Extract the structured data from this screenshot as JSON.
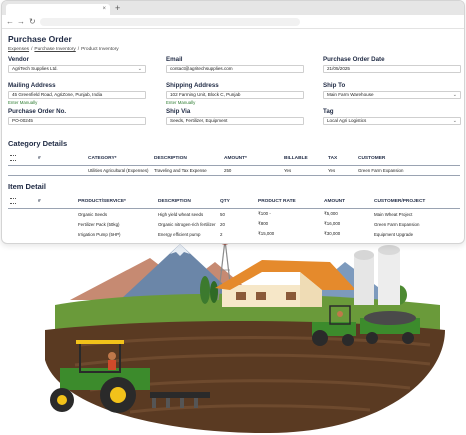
{
  "browser": {
    "tab_close": "×",
    "new_tab": "+",
    "back": "←",
    "forward": "→",
    "reload": "↻"
  },
  "page": {
    "title": "Purchase Order",
    "breadcrumb": [
      "Expenses",
      "Purchase Inventory",
      "Product Inventory"
    ],
    "breadcrumb_sep": "/"
  },
  "form": {
    "vendor": {
      "label": "Vendor",
      "value": "AgriTech Supplies Ltd."
    },
    "email": {
      "label": "Email",
      "value": "contact@agritechsupplies.com"
    },
    "po_date": {
      "label": "Purchase Order Date",
      "value": "21/05/2025"
    },
    "mailing_address": {
      "label": "Mailing Address",
      "value": "45 Greenfield Road, AgriZone, Punjab, India",
      "hint": "Enter Manually"
    },
    "shipping_address": {
      "label": "Shipping Address",
      "value": "102 Farming Unit, Block C, Punjab",
      "hint": "Enter Manually"
    },
    "ship_to": {
      "label": "Ship To",
      "value": "Main Farm Warehouse"
    },
    "po_number": {
      "label": "Purchase Order No.",
      "value": "PO-00245"
    },
    "ship_via": {
      "label": "Ship Via",
      "value": "Seeds, Fertilizer, Equipment"
    },
    "tag": {
      "label": "Tag",
      "value": "Local Agri Logistics"
    }
  },
  "category_details": {
    "title": "Category Details",
    "headers": [
      "#",
      "CATEGORY*",
      "DESCRIPTION",
      "AMOUNT*",
      "BILLABLE",
      "TAX",
      "CUSTOMER"
    ],
    "rows": [
      [
        "",
        "Utilities Agricultural (Expenses)",
        "Traveling and Tax Expense",
        "250",
        "Yes",
        "Yes",
        "Green Farm Expansion"
      ]
    ]
  },
  "item_detail": {
    "title": "Item Detail",
    "headers": [
      "#",
      "PRODUCT/SERVICE*",
      "DESCRIPTION",
      "QTY",
      "PRODUCT RATE",
      "AMOUNT",
      "CUSTOMER/PROJECT"
    ],
    "rows": [
      [
        "",
        "Organic Seeds",
        "High yield wheat seeds",
        "50",
        "₹100 -",
        "₹5,000",
        "Main Wheat Project"
      ],
      [
        "",
        "Fertilizer Pack (50kg)",
        "Organic nitrogen-rich fertilizer",
        "20",
        "₹800",
        "₹16,000",
        "Green Farm Expansion"
      ],
      [
        "",
        "Irrigation Pump (5HP)",
        "Energy efficient pump",
        "2",
        "₹15,000",
        "₹30,000",
        "Equipment Upgrade"
      ]
    ]
  },
  "colors": {
    "heading": "#1f2a44",
    "hint_green": "#2e7d32",
    "soil": "#5a3a22",
    "field_green": "#6a9a3a",
    "tractor_green": "#3c8b2c",
    "roof_orange": "#e58a2c",
    "mountain_blue": "#6b86a8"
  }
}
